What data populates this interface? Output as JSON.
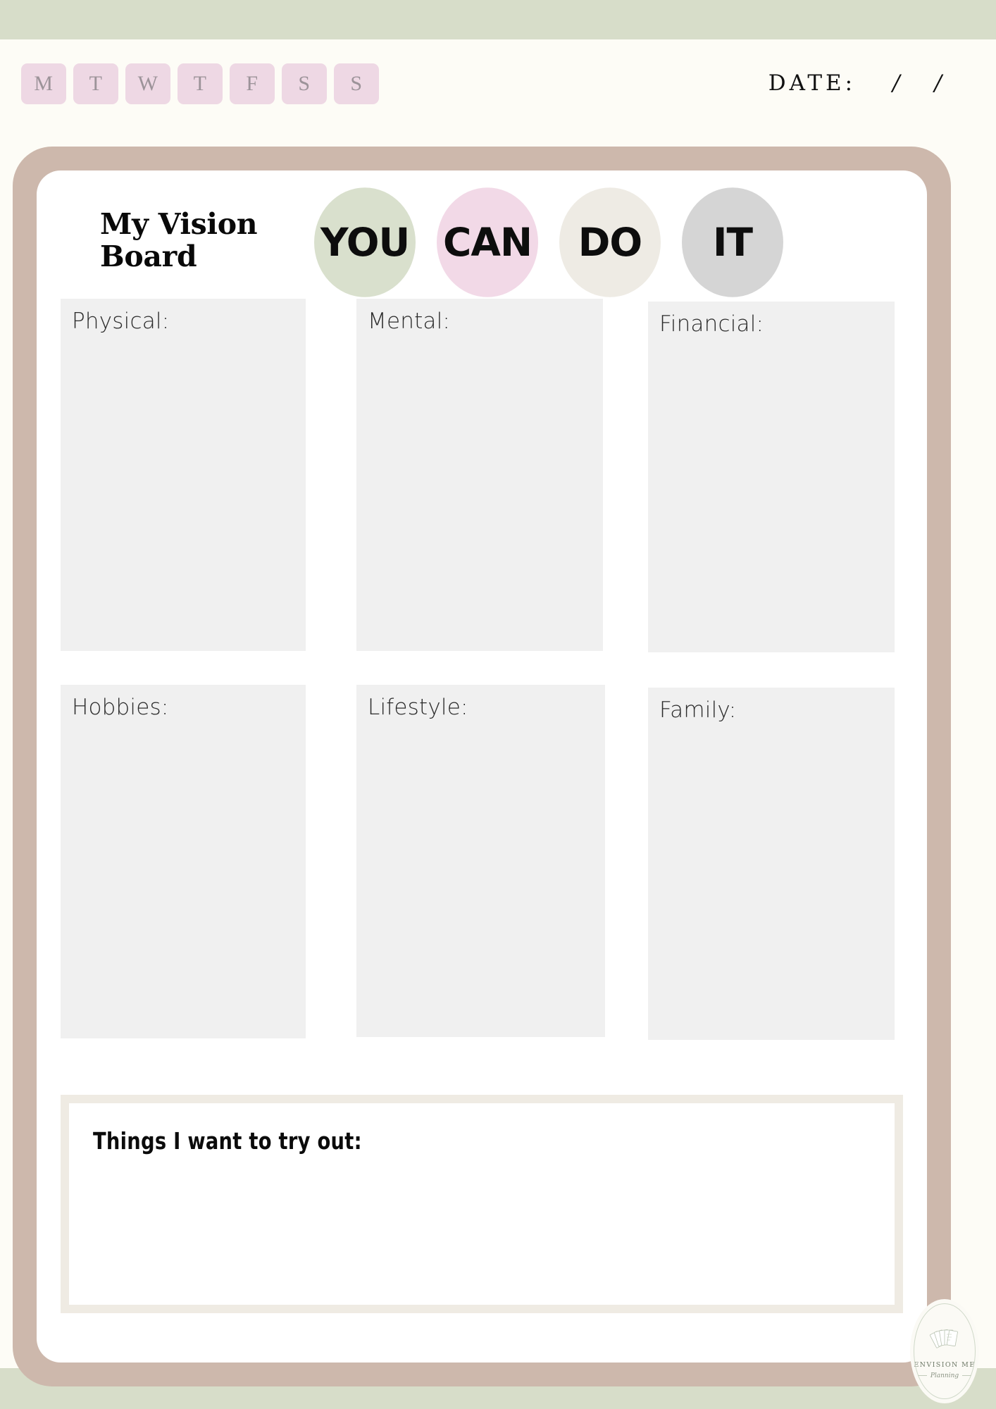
{
  "theme": {
    "band_color": "#d7ddc9",
    "page_bg": "#fdfcf6",
    "frame_color": "#cdb8ac",
    "card_bg": "#ffffff",
    "box_fill": "#f0f0f0",
    "day_chip_bg": "#eed8e4",
    "day_chip_text": "#9c9399",
    "tryout_border": "#efebe3"
  },
  "header": {
    "days": [
      {
        "label": "M",
        "name": "monday"
      },
      {
        "label": "T",
        "name": "tuesday"
      },
      {
        "label": "W",
        "name": "wednesday"
      },
      {
        "label": "T",
        "name": "thursday"
      },
      {
        "label": "F",
        "name": "friday"
      },
      {
        "label": "S",
        "name": "saturday"
      },
      {
        "label": "S",
        "name": "sunday"
      }
    ],
    "date_label": "DATE:",
    "date_separator_1": "/",
    "date_separator_2": "/",
    "date_value": ""
  },
  "title": {
    "line1": "My Vision",
    "line2": "Board",
    "full": "My Vision Board"
  },
  "slogan": {
    "circles": [
      {
        "text": "YOU",
        "color": "#d9e0cd"
      },
      {
        "text": "CAN",
        "color": "#f2d9e7"
      },
      {
        "text": "DO",
        "color": "#eeebe4"
      },
      {
        "text": "IT",
        "color": "#d5d5d5"
      }
    ]
  },
  "goals": [
    {
      "label": "Physical:",
      "value": "",
      "name": "physical"
    },
    {
      "label": "Mental:",
      "value": "",
      "name": "mental"
    },
    {
      "label": "Financial:",
      "value": "",
      "name": "financial"
    },
    {
      "label": "Hobbies:",
      "value": "",
      "name": "hobbies"
    },
    {
      "label": "Lifestyle:",
      "value": "",
      "name": "lifestyle"
    },
    {
      "label": "Family:",
      "value": "",
      "name": "family"
    }
  ],
  "tryout": {
    "label": "Things I want to try out:",
    "value": ""
  },
  "brand": {
    "name": "ENVISION ME",
    "tagline": "Planning",
    "icon": "fanned-cards-icon"
  }
}
